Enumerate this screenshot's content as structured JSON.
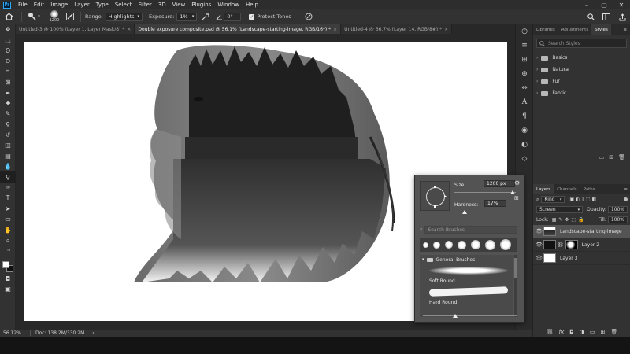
{
  "menubar": {
    "logo": "Ps",
    "items": [
      "File",
      "Edit",
      "Image",
      "Layer",
      "Type",
      "Select",
      "Filter",
      "3D",
      "View",
      "Plugins",
      "Window",
      "Help"
    ]
  },
  "options": {
    "brush_size": "1200",
    "range_label": "Range:",
    "range_value": "Highlights",
    "exposure_label": "Exposure:",
    "exposure_value": "1%",
    "angle_value": "0°",
    "protect_tones_label": "Protect Tones",
    "protect_tones_checked": true
  },
  "tabs": [
    {
      "label": "Untitled-3 @ 100% (Layer 1, Layer Mask/8) *",
      "active": false
    },
    {
      "label": "Double exposure composite.psd @ 56.1% (Landscape-starting-image, RGB/16*) *",
      "active": true
    },
    {
      "label": "Untitled-4 @ 66.7% (Layer 14, RGB/8#) *",
      "active": false
    }
  ],
  "tools": [
    "move",
    "marquee",
    "lasso",
    "quick-select",
    "crop",
    "frame",
    "eyedropper",
    "spot-heal",
    "brush",
    "clone-stamp",
    "history-brush",
    "eraser",
    "gradient",
    "blur",
    "burn",
    "pen",
    "type",
    "path-select",
    "rectangle",
    "hand",
    "zoom",
    "more"
  ],
  "status": {
    "zoom": "56.12%",
    "doc": "Doc: 138.2M/330.2M"
  },
  "styles_panel": {
    "tabs": [
      "Libraries",
      "Adjustments",
      "Styles"
    ],
    "active_tab": "Styles",
    "search_placeholder": "Search Styles",
    "folders": [
      "Basics",
      "Natural",
      "Fur",
      "Fabric"
    ]
  },
  "layers_panel": {
    "tabs": [
      "Layers",
      "Channels",
      "Paths"
    ],
    "active_tab": "Layers",
    "kind_label": "Kind",
    "blend_mode": "Screen",
    "opacity_label": "Opacity:",
    "opacity_value": "100%",
    "lock_label": "Lock:",
    "fill_label": "Fill:",
    "fill_value": "100%",
    "layers": [
      {
        "name": "Landscape-starting-image",
        "selected": true
      },
      {
        "name": "Layer 2",
        "selected": false
      },
      {
        "name": "Layer 3",
        "selected": false
      }
    ]
  },
  "brush_popup": {
    "size_label": "Size:",
    "size_value": "1200 px",
    "size_level": 0.95,
    "hardness_label": "Hardness:",
    "hardness_value": "17%",
    "hardness_level": 0.17,
    "search_placeholder": "Search Brushes",
    "group_name": "General Brushes",
    "brushes": [
      "Soft Round",
      "Hard Round"
    ]
  },
  "colors": {
    "accent": "#31a8ff",
    "panel_bg": "#323232",
    "canvas": "#ffffff"
  }
}
